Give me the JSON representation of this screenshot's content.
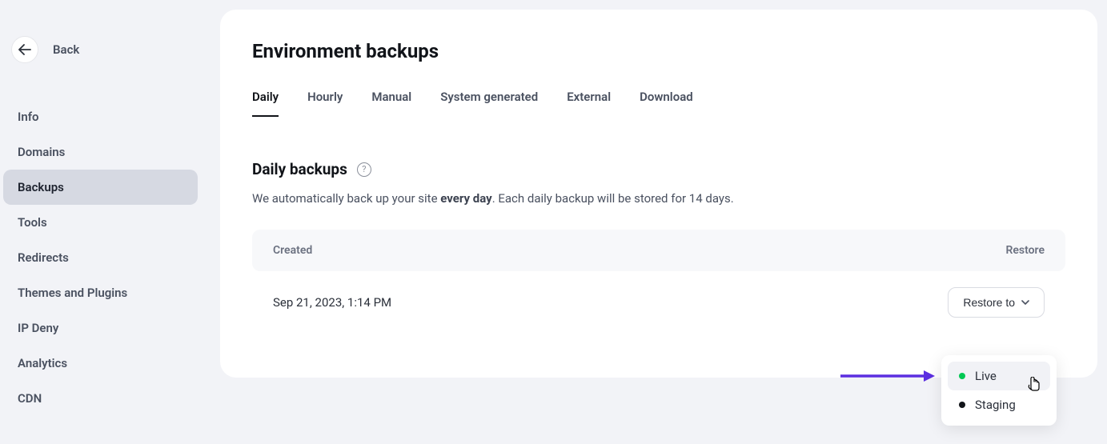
{
  "sidebar": {
    "back_label": "Back",
    "items": [
      {
        "label": "Info",
        "active": false
      },
      {
        "label": "Domains",
        "active": false
      },
      {
        "label": "Backups",
        "active": true
      },
      {
        "label": "Tools",
        "active": false
      },
      {
        "label": "Redirects",
        "active": false
      },
      {
        "label": "Themes and Plugins",
        "active": false
      },
      {
        "label": "IP Deny",
        "active": false
      },
      {
        "label": "Analytics",
        "active": false
      },
      {
        "label": "CDN",
        "active": false
      }
    ]
  },
  "page": {
    "title": "Environment backups"
  },
  "tabs": [
    {
      "label": "Daily",
      "active": true
    },
    {
      "label": "Hourly",
      "active": false
    },
    {
      "label": "Manual",
      "active": false
    },
    {
      "label": "System generated",
      "active": false
    },
    {
      "label": "External",
      "active": false
    },
    {
      "label": "Download",
      "active": false
    }
  ],
  "section": {
    "title": "Daily backups",
    "desc_prefix": "We automatically back up your site ",
    "desc_bold": "every day",
    "desc_suffix": ". Each daily backup will be stored for 14 days."
  },
  "table": {
    "head_created": "Created",
    "head_restore": "Restore",
    "rows": [
      {
        "created": "Sep 21, 2023, 1:14 PM",
        "button": "Restore to"
      }
    ]
  },
  "dropdown": {
    "options": [
      {
        "label": "Live",
        "dot": "green",
        "hover": true
      },
      {
        "label": "Staging",
        "dot": "black",
        "hover": false
      }
    ]
  }
}
